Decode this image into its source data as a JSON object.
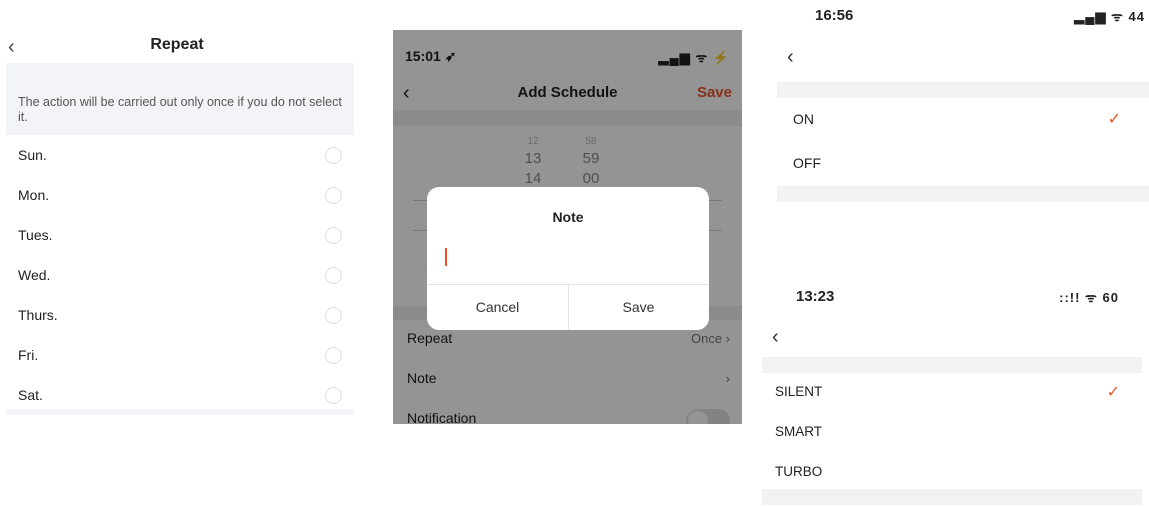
{
  "colors": {
    "accent": "#e8562a",
    "band": "#f2f2f2"
  },
  "repeat_panel": {
    "title": "Repeat",
    "back_icon": "chevron-left-icon",
    "back_glyph": "‹",
    "hint": "The action will be carried out only once if you do not select it.",
    "days": [
      {
        "label": "Sun.",
        "selected": false
      },
      {
        "label": "Mon.",
        "selected": false
      },
      {
        "label": "Tues.",
        "selected": false
      },
      {
        "label": "Wed.",
        "selected": false
      },
      {
        "label": "Thurs.",
        "selected": false
      },
      {
        "label": "Fri.",
        "selected": false
      },
      {
        "label": "Sat.",
        "selected": false
      }
    ]
  },
  "schedule_panel": {
    "status": {
      "time": "15:01 ➶",
      "icons": "▂▄▆ ᯤ ⚡"
    },
    "nav": {
      "back_glyph": "‹",
      "title": "Add Schedule",
      "save": "Save"
    },
    "picker": {
      "hours": [
        "12",
        "13",
        "14"
      ],
      "minutes": [
        "58",
        "59",
        "00"
      ]
    },
    "rows": [
      {
        "label": "Repeat",
        "value": "Once  ›"
      },
      {
        "label": "Note",
        "value": "›"
      },
      {
        "label": "Notification",
        "toggle": false
      }
    ],
    "dialog": {
      "title": "Note",
      "input_value": "",
      "cancel": "Cancel",
      "save": "Save"
    }
  },
  "power_panel": {
    "status": {
      "time": "16:56",
      "icons": "▂▄▆ ᯤ 44"
    },
    "back_glyph": "‹",
    "options": [
      {
        "label": "ON",
        "selected": true
      },
      {
        "label": "OFF",
        "selected": false
      }
    ],
    "check_glyph": "✓"
  },
  "mode_panel": {
    "status": {
      "time": "13:23",
      "icons": "::!! ᯤ 60"
    },
    "back_glyph": "‹",
    "options": [
      {
        "label": "SILENT",
        "selected": true
      },
      {
        "label": "SMART",
        "selected": false
      },
      {
        "label": "TURBO",
        "selected": false
      }
    ],
    "check_glyph": "✓"
  }
}
